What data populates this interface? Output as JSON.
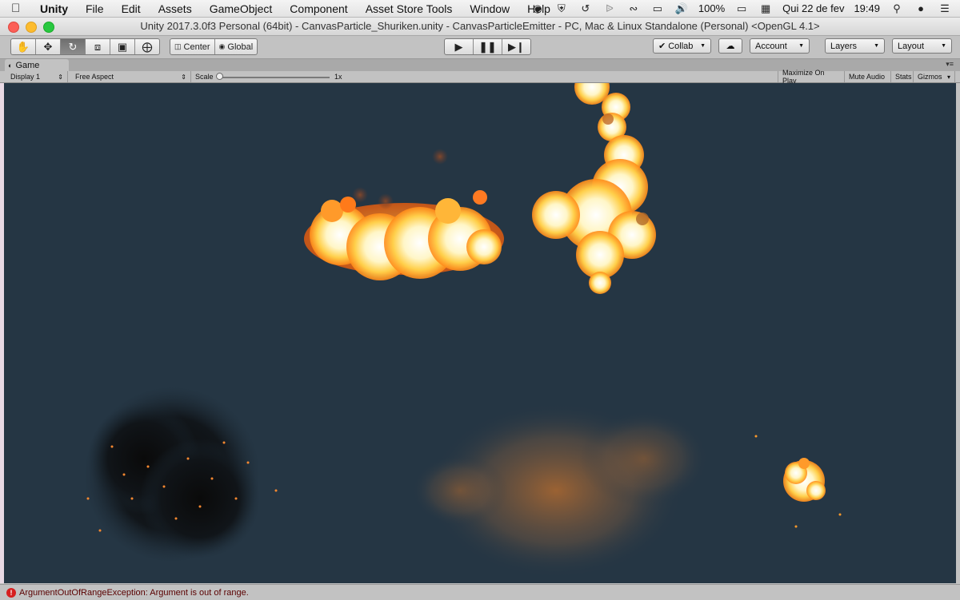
{
  "menubar": {
    "app": "Unity",
    "items": [
      "File",
      "Edit",
      "Assets",
      "GameObject",
      "Component",
      "Asset Store Tools",
      "Window",
      "Help"
    ],
    "battery": "100%",
    "date": "Qui 22 de fev",
    "time": "19:49"
  },
  "window": {
    "title": "Unity 2017.3.0f3 Personal (64bit) - CanvasParticle_Shuriken.unity - CanvasParticleEmitter - PC, Mac & Linux Standalone (Personal) <OpenGL 4.1>"
  },
  "toolbar": {
    "transform_tools": [
      "hand-icon",
      "move-icon",
      "rotate-icon",
      "scale-icon",
      "rect-icon",
      "transform-icon"
    ],
    "pivot_label": "Center",
    "space_label": "Global",
    "collab_label": "Collab",
    "account_label": "Account",
    "layers_label": "Layers",
    "layout_label": "Layout"
  },
  "game": {
    "tab_label": "Game",
    "display": "Display 1",
    "aspect": "Free Aspect",
    "scale_label": "Scale",
    "scale_value": "1x",
    "maximize": "Maximize On Play",
    "mute": "Mute Audio",
    "stats": "Stats",
    "gizmos": "Gizmos",
    "background_color": "#253644"
  },
  "status": {
    "message": "ArgumentOutOfRangeException: Argument is out of range."
  }
}
